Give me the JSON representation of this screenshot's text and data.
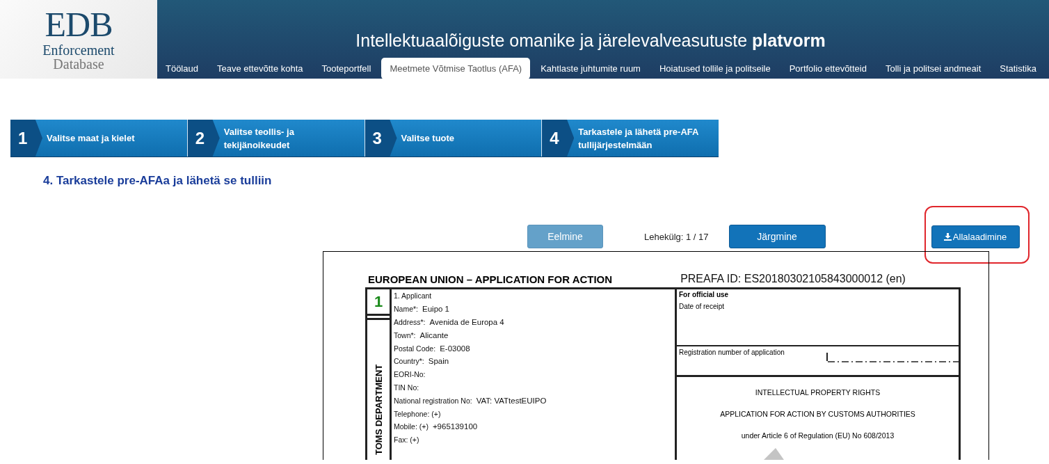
{
  "header": {
    "logo": {
      "mark": "EDB",
      "line_1": "Enforcement",
      "line_2": "Database"
    },
    "title": "Intellektuaalõiguste omanike ja järelevalveasutuste **platvorm**",
    "nav": [
      {
        "label": "Töölaud",
        "selected": false
      },
      {
        "label": "Teave ettevõtte kohta",
        "selected": false
      },
      {
        "label": "Tooteportfell",
        "selected": false
      },
      {
        "label": "Meetmete Võtmise Taotlus (AFA)",
        "selected": true
      },
      {
        "label": "Kahtlaste juhtumite ruum",
        "selected": false
      },
      {
        "label": "Hoiatused tollile ja politseile",
        "selected": false
      },
      {
        "label": "Portfolio ettevõtteid",
        "selected": false
      },
      {
        "label": "Tolli ja politsei andmeait",
        "selected": false
      },
      {
        "label": "Statistika",
        "selected": false
      }
    ]
  },
  "steps": [
    {
      "number": "1",
      "label": "Valitse maat ja kielet"
    },
    {
      "number": "2",
      "label": "Valitse teollis- ja tekijänoikeudet"
    },
    {
      "number": "3",
      "label": "Valitse tuote"
    },
    {
      "number": "4",
      "label": "Tarkastele ja lähetä pre-AFA tullijärjestelmään"
    }
  ],
  "heading": "4. Tarkastele pre-AFAa ja lähetä se tulliin",
  "pager": {
    "previous": {
      "label": "Eelmine",
      "disabled": true
    },
    "page_label": "Lehekülg: 1 / 17",
    "next": {
      "label": "Järgmine",
      "disabled": false
    },
    "download": {
      "label": "Allalaadimine",
      "highlighted": true
    }
  },
  "document": {
    "title": "EUROPEAN UNION – APPLICATION FOR ACTION",
    "preafa_id": "PREAFA ID: ES20180302105843000012 (en)",
    "section_number": "1",
    "side_label": "TOMS DEPARTMENT",
    "applicant_heading": "1. Applicant",
    "fields": [
      {
        "label": "Name*:",
        "value": "Euipo 1"
      },
      {
        "label": "Address*:",
        "value": "Avenida de Europa 4"
      },
      {
        "label": "Town*:",
        "value": "Alicante"
      },
      {
        "label": "Postal Code:",
        "value": "E-03008"
      },
      {
        "label": "Country*:",
        "value": "Spain"
      },
      {
        "label": "EORI-No:"
      },
      {
        "label": "TIN No:"
      },
      {
        "label": "National registration No:",
        "value": "VAT: VATtestEUIPO"
      },
      {
        "label": "Telephone: (+)"
      },
      {
        "label": "Mobile: (+)",
        "value": "+965139100"
      },
      {
        "label": "Fax: (+)"
      }
    ],
    "official": {
      "heading": "For official use",
      "date_label": "Date of receipt",
      "registration_label": "Registration number of application",
      "lines": [
        "INTELLECTUAL PROPERTY RIGHTS",
        "APPLICATION FOR ACTION BY CUSTOMS AUTHORITIES",
        "under Article 6 of Regulation (EU) No 608/2013"
      ]
    }
  }
}
